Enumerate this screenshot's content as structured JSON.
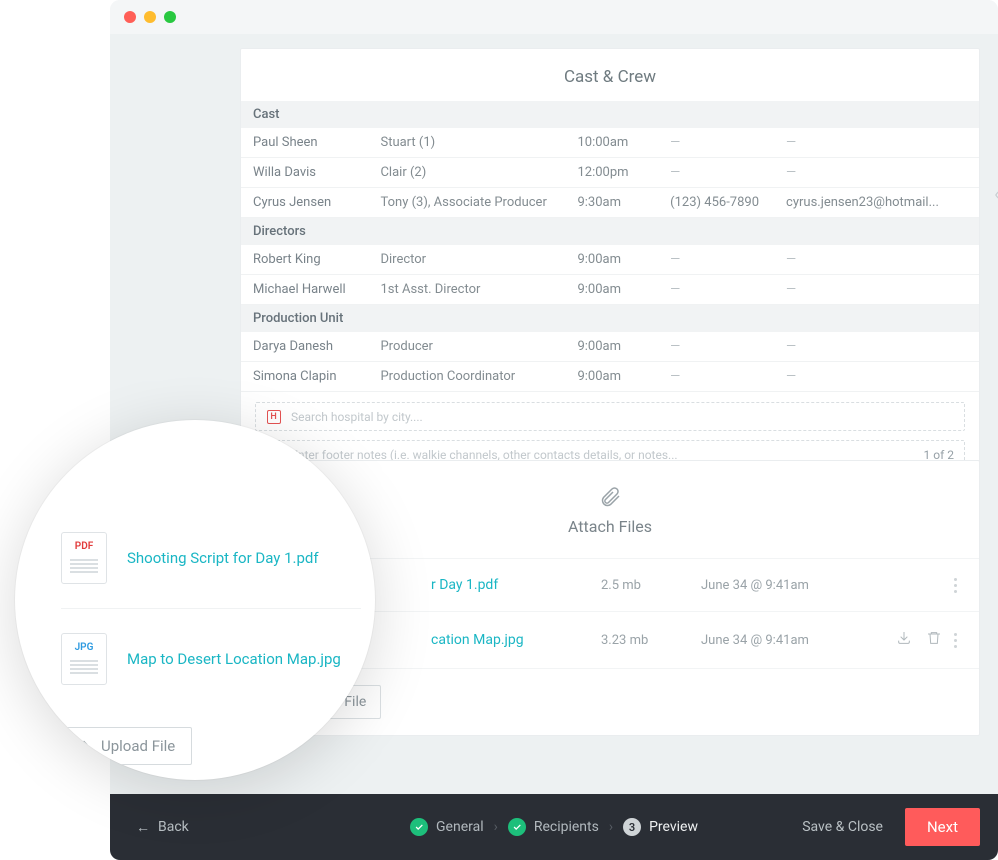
{
  "castcrew": {
    "title": "Cast & Crew",
    "groups": [
      {
        "name": "Cast",
        "rows": [
          {
            "name": "Paul Sheen",
            "role": "Stuart (1)",
            "time": "10:00am",
            "phone": "—",
            "email": "—"
          },
          {
            "name": "Willa Davis",
            "role": "Clair (2)",
            "time": "12:00pm",
            "phone": "—",
            "email": "—"
          },
          {
            "name": "Cyrus Jensen",
            "role": "Tony (3), Associate Producer",
            "time": "9:30am",
            "phone": "(123) 456-7890",
            "email": "cyrus.jensen23@hotmail..."
          }
        ]
      },
      {
        "name": "Directors",
        "rows": [
          {
            "name": "Robert King",
            "role": "Director",
            "time": "9:00am",
            "phone": "—",
            "email": "—"
          },
          {
            "name": "Michael Harwell",
            "role": "1st Asst. Director",
            "time": "9:00am",
            "phone": "—",
            "email": "—"
          }
        ]
      },
      {
        "name": "Production Unit",
        "rows": [
          {
            "name": "Darya Danesh",
            "role": "Producer",
            "time": "9:00am",
            "phone": "—",
            "email": "—"
          },
          {
            "name": "Simona Clapin",
            "role": "Production Coordinator",
            "time": "9:00am",
            "phone": "—",
            "email": "—"
          }
        ]
      }
    ],
    "hospital_placeholder": "Search hospital by city....",
    "footer_placeholder": "Enter footer notes (i.e. walkie channels, other contacts details, or notes...",
    "page": "1 of 2"
  },
  "attach": {
    "title": "Attach Files",
    "files": [
      {
        "ext": "PDF",
        "ext_class": "pdf",
        "name": "Shooting Script for Day 1.pdf",
        "bg_name": "r Day 1.pdf",
        "size": "2.5 mb",
        "date": "June 34 @ 9:41am"
      },
      {
        "ext": "JPG",
        "ext_class": "jpg",
        "name": "Map to Desert Location Map.jpg",
        "bg_name": "cation Map.jpg",
        "size": "3.23 mb",
        "date": "June 34 @ 9:41am"
      }
    ],
    "upload_label": "Upload File"
  },
  "footer": {
    "back": "Back",
    "step1": "General",
    "step2": "Recipients",
    "step3_num": "3",
    "step3": "Preview",
    "save": "Save & Close",
    "next": "Next"
  },
  "zoom": {
    "file1": "Shooting Script for Day 1.pdf",
    "file2": "Map to Desert Location Map.jpg",
    "upload": "Upload File"
  }
}
